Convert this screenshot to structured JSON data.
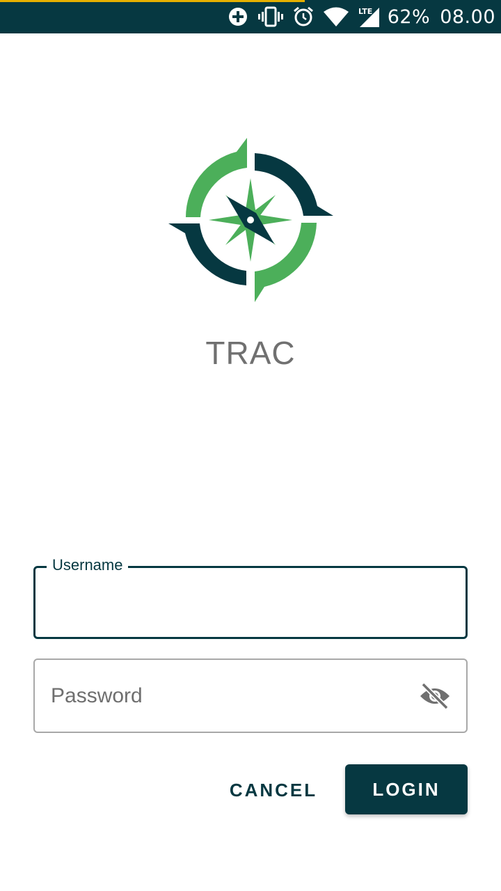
{
  "status_bar": {
    "battery_percent": "62%",
    "time": "08.00",
    "network_label": "LTE",
    "icons": [
      "data-saver-icon",
      "vibrate-icon",
      "alarm-icon",
      "wifi-icon",
      "lte-signal-icon"
    ]
  },
  "app": {
    "name": "TRAC",
    "logo": "compass-logo",
    "colors": {
      "primary": "#063841",
      "accent": "#4caf5a",
      "text_muted": "#707070"
    }
  },
  "form": {
    "username": {
      "label": "Username",
      "value": ""
    },
    "password": {
      "placeholder": "Password",
      "value": "",
      "toggle_icon": "visibility-off-icon"
    },
    "cancel_label": "CANCEL",
    "login_label": "LOGIN"
  }
}
